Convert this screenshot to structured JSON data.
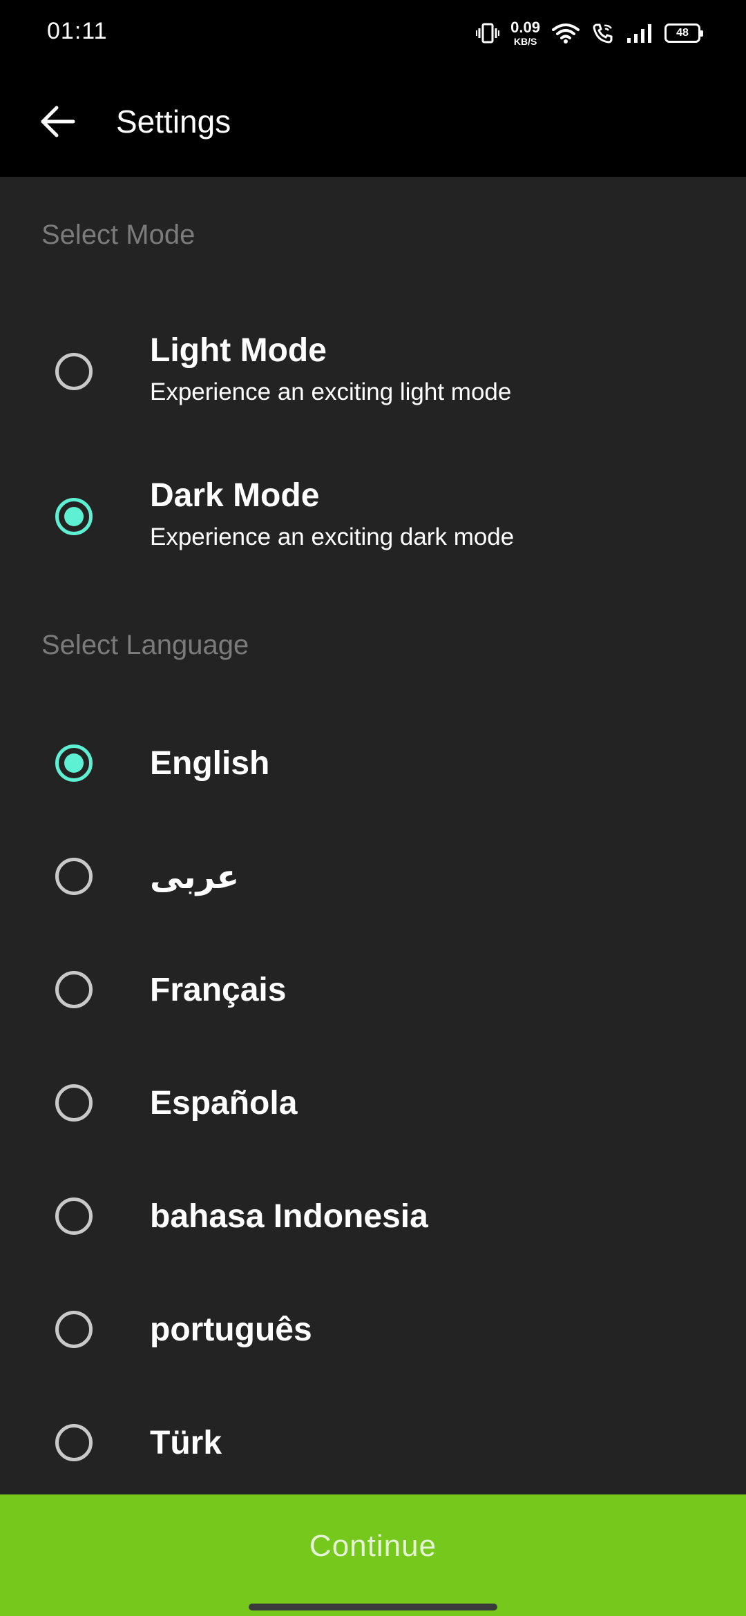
{
  "status_bar": {
    "time": "01:11",
    "net_speed_value": "0.09",
    "net_speed_unit": "KB/S",
    "battery": "48",
    "icons": [
      "vibrate-icon",
      "wifi-icon",
      "wifi-calling-icon",
      "signal-icon",
      "battery-icon"
    ]
  },
  "app_bar": {
    "back_icon": "arrow-left-icon",
    "title": "Settings"
  },
  "mode_section": {
    "label": "Select Mode",
    "options": [
      {
        "title": "Light Mode",
        "subtitle": "Experience an exciting light mode",
        "selected": false
      },
      {
        "title": "Dark Mode",
        "subtitle": "Experience an exciting dark mode",
        "selected": true
      }
    ]
  },
  "language_section": {
    "label": "Select Language",
    "options": [
      {
        "label": "English",
        "selected": true
      },
      {
        "label": "عربى",
        "selected": false
      },
      {
        "label": "Français",
        "selected": false
      },
      {
        "label": "Española",
        "selected": false
      },
      {
        "label": "bahasa Indonesia",
        "selected": false
      },
      {
        "label": "português",
        "selected": false
      },
      {
        "label": "Türk",
        "selected": false
      }
    ]
  },
  "continue_button": {
    "label": "Continue"
  },
  "colors": {
    "background": "#232323",
    "bar": "#000000",
    "accent_radio": "#5ef0d2",
    "button": "#77c81c",
    "section_label": "#7b7b7b"
  }
}
